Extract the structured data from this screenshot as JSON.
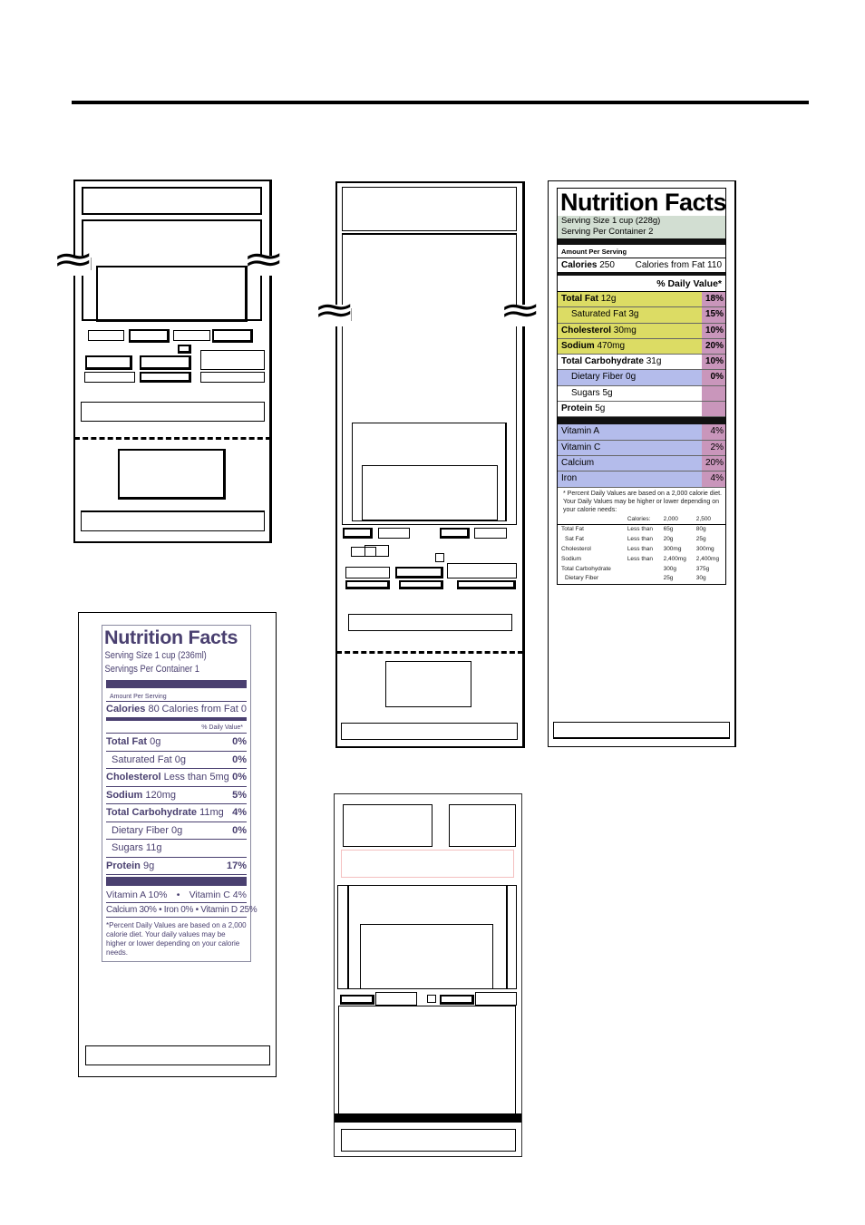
{
  "figure": {
    "description": "Nutrition Facts label placement diagrams on package layouts"
  },
  "label_standard": {
    "title": "Nutrition Facts",
    "serving_size": "Serving Size 1 cup (228g)",
    "servings_per_container": "Serving Per Container 2",
    "amount_per_serving": "Amount Per Serving",
    "calories_label": "Calories",
    "calories_value": "250",
    "calories_from_fat": "Calories from Fat 110",
    "daily_value_header": "% Daily Value*",
    "nutrients": [
      {
        "name": "Total Fat",
        "amount": "12g",
        "percent": "18%",
        "bold": true,
        "indent": false,
        "color": "#dcdc64"
      },
      {
        "name": "Saturated Fat",
        "amount": "3g",
        "percent": "15%",
        "bold": false,
        "indent": true,
        "color": "#dcdc64"
      },
      {
        "name": "Cholesterol",
        "amount": "30mg",
        "percent": "10%",
        "bold": true,
        "indent": false,
        "color": "#dcdc64"
      },
      {
        "name": "Sodium",
        "amount": "470mg",
        "percent": "20%",
        "bold": true,
        "indent": false,
        "color": "#dcdc64"
      },
      {
        "name": "Total Carbohydrate",
        "amount": "31g",
        "percent": "10%",
        "bold": true,
        "indent": false,
        "color": "#ffffff"
      },
      {
        "name": "Dietary Fiber",
        "amount": "0g",
        "percent": "0%",
        "bold": false,
        "indent": true,
        "color": "#b4bceb"
      },
      {
        "name": "Sugars",
        "amount": "5g",
        "percent": "",
        "bold": false,
        "indent": true,
        "color": "#ffffff"
      },
      {
        "name": "Protein",
        "amount": "5g",
        "percent": "",
        "bold": true,
        "indent": false,
        "color": "#ffffff"
      }
    ],
    "vitamins": [
      {
        "name": "Vitamin A",
        "percent": "4%"
      },
      {
        "name": "Vitamin C",
        "percent": "2%"
      },
      {
        "name": "Calcium",
        "percent": "20%"
      },
      {
        "name": "Iron",
        "percent": "4%"
      }
    ],
    "footnote": "* Percent Daily Values are based on a 2,000 calorie diet. Your Daily Values may be higher or lower depending on your calorie needs:",
    "dv_table": {
      "header": [
        "",
        "Calories:",
        "2,000",
        "2,500"
      ],
      "rows": [
        [
          "Total Fat",
          "Less than",
          "65g",
          "80g"
        ],
        [
          "Sat Fat",
          "Less than",
          "20g",
          "25g"
        ],
        [
          "Cholesterol",
          "Less than",
          "300mg",
          "300mg"
        ],
        [
          "Sodium",
          "Less than",
          "2,400mg",
          "2,400mg"
        ],
        [
          "Total Carbohydrate",
          "",
          "300g",
          "375g"
        ],
        [
          "Dietary Fiber",
          "",
          "25g",
          "30g"
        ]
      ]
    },
    "colors": {
      "serving_bg": "#d2ded2",
      "fat_rows": "#dcdc64",
      "percent_col": "#c996bb",
      "vitamin_rows": "#b4bceb"
    }
  },
  "label_simplified": {
    "title": "Nutrition Facts",
    "serving_size": "Serving Size 1 cup (236ml)",
    "servings_per_container": "Servings Per Container 1",
    "amount_per_serving": "Amount Per Serving",
    "calories_label": "Calories",
    "calories_value": "80",
    "calories_from_fat": "Calories from Fat 0",
    "daily_value_header": "% Daily Value*",
    "nutrients": [
      {
        "name": "Total Fat",
        "amount": "0g",
        "percent": "0%",
        "bold": true,
        "indent": false
      },
      {
        "name": "Saturated Fat",
        "amount": "0g",
        "percent": "0%",
        "bold": false,
        "indent": true
      },
      {
        "name": "Cholesterol",
        "amount": "Less than 5mg",
        "percent": "0%",
        "bold": true,
        "indent": false
      },
      {
        "name": "Sodium",
        "amount": "120mg",
        "percent": "5%",
        "bold": true,
        "indent": false
      },
      {
        "name": "Total Carbohydrate",
        "amount": "11mg",
        "percent": "4%",
        "bold": true,
        "indent": false
      },
      {
        "name": "Dietary Fiber",
        "amount": "0g",
        "percent": "0%",
        "bold": false,
        "indent": true
      },
      {
        "name": "Sugars",
        "amount": "11g",
        "percent": "",
        "bold": false,
        "indent": true
      },
      {
        "name": "Protein",
        "amount": "9g",
        "percent": "17%",
        "bold": true,
        "indent": false
      }
    ],
    "vitamin_line_1": [
      "Vitamin A 10%",
      "•",
      "Vitamin C 4%"
    ],
    "vitamin_line_2": "Calcium 30% • Iron 0% • Vitamin D 25%",
    "footnote": "*Percent Daily Values are based on a 2,000 calorie diet. Your daily values may be higher or lower depending on your calorie needs.",
    "color": "#4a4070"
  }
}
